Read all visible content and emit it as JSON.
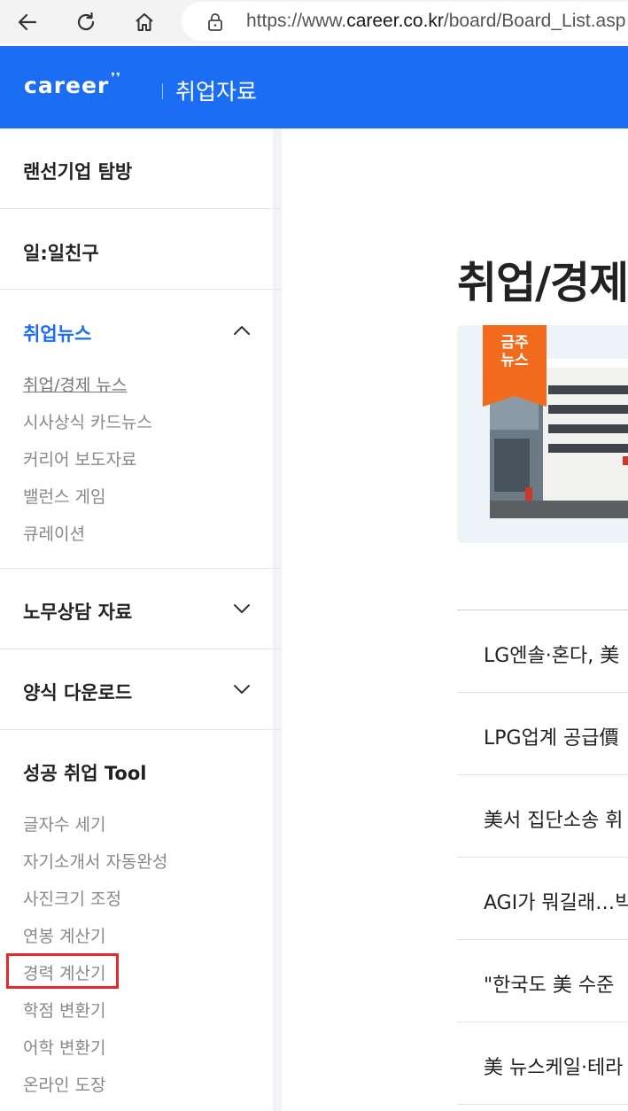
{
  "browser": {
    "url_prefix": "https://www.",
    "url_host": "career.co.kr",
    "url_path": "/board/Board_List.asp"
  },
  "header": {
    "logo_text": "career",
    "logo_mark": "❜❜",
    "title": "취업자료"
  },
  "sidebar": {
    "sections": [
      {
        "label": "랜선기업 탐방"
      },
      {
        "label": "일:일친구"
      },
      {
        "label": "취업뉴스",
        "expanded": true,
        "items": [
          "취업/경제 뉴스",
          "시사상식 카드뉴스",
          "커리어 보도자료",
          "밸런스 게임",
          "큐레이션"
        ]
      },
      {
        "label": "노무상담 자료",
        "expanded": false
      },
      {
        "label": "양식 다운로드",
        "expanded": false
      },
      {
        "label": "성공 취업 Tool",
        "items": [
          "글자수 세기",
          "자기소개서 자동완성",
          "사진크기 조정",
          "연봉 계산기",
          "경력 계산기",
          "학점 변환기",
          "어학 변환기",
          "온라인 도장"
        ]
      }
    ],
    "colors": {
      "active": "#1b6ef3",
      "highlight": "#e52a2a"
    }
  },
  "main": {
    "page_title": "취업/경제",
    "badge_text": "금주\n뉴스",
    "news": [
      "LG엔솔·혼다, 美",
      "LPG업계 공급價",
      "美서 집단소송 휘",
      "AGI가 뭐길래…빅",
      "\"한국도 美 수준",
      "美 뉴스케일·테라"
    ]
  }
}
